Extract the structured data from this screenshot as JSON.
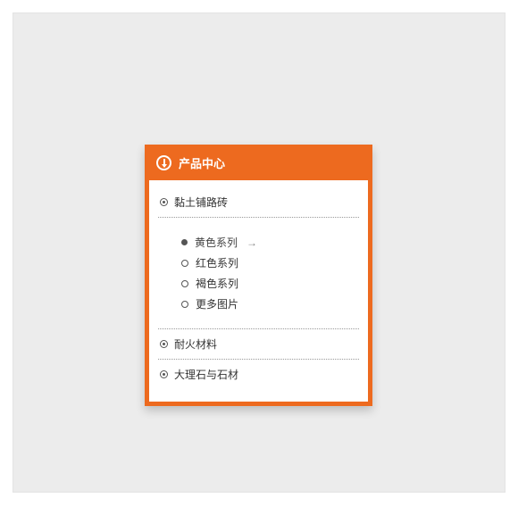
{
  "panel": {
    "title": "产品中心",
    "categories": [
      {
        "label": "黏土铺路砖",
        "expanded": true
      },
      {
        "label": "耐火材料",
        "expanded": false
      },
      {
        "label": "大理石与石材",
        "expanded": false
      }
    ],
    "subitems": [
      {
        "label": "黄色系列",
        "active": true
      },
      {
        "label": "红色系列",
        "active": false
      },
      {
        "label": "褐色系列",
        "active": false
      },
      {
        "label": "更多图片",
        "active": false
      }
    ]
  }
}
